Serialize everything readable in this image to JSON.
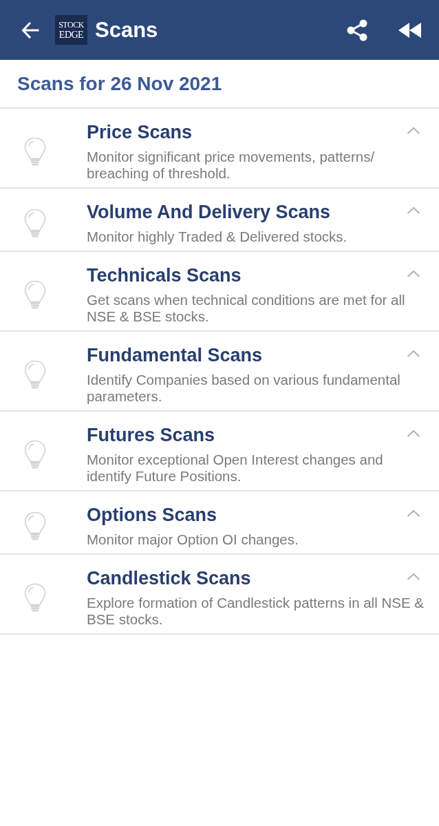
{
  "app_bar": {
    "logo": {
      "line_1": "STOCK",
      "line_2": "EDGE"
    },
    "title": "Scans"
  },
  "heading": "Scans for 26 Nov 2021",
  "scan_categories": [
    {
      "title": "Price Scans",
      "description": "Monitor significant price movements, patterns/ breaching of threshold."
    },
    {
      "title": "Volume And Delivery Scans",
      "description": "Monitor highly Traded & Delivered stocks."
    },
    {
      "title": "Technicals Scans",
      "description": "Get scans when technical conditions are met for all NSE & BSE stocks."
    },
    {
      "title": "Fundamental Scans",
      "description": "Identify Companies based on various fundamental parameters."
    },
    {
      "title": "Futures Scans",
      "description": "Monitor exceptional Open Interest changes and identify Future Positions."
    },
    {
      "title": "Options Scans",
      "description": "Monitor major Option OI changes."
    },
    {
      "title": "Candlestick Scans",
      "description": "Explore formation of Candlestick patterns in all NSE & BSE stocks."
    }
  ]
}
